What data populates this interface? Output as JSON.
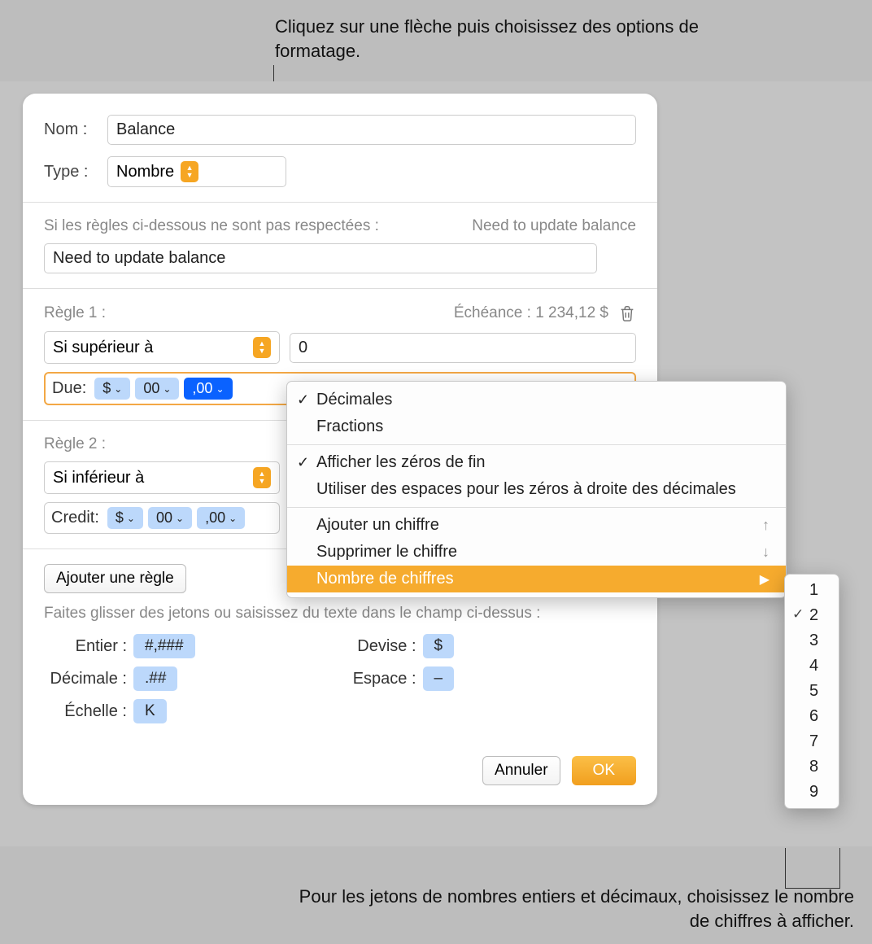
{
  "callouts": {
    "top": "Cliquez sur une flèche puis choisissez des options de formatage.",
    "bottom": "Pour les jetons de nombres entiers et décimaux, choisissez le nombre de chiffres à afficher."
  },
  "form": {
    "name_label": "Nom :",
    "name_value": "Balance",
    "type_label": "Type :",
    "type_value": "Nombre",
    "fallback_label": "Si les règles ci-dessous ne sont pas respectées :",
    "fallback_preview": "Need to update balance",
    "fallback_value": "Need to update balance"
  },
  "rule1": {
    "title": "Règle 1 :",
    "preview": "Échéance : 1 234,12 $",
    "condition": "Si supérieur à",
    "value": "0",
    "prefix": "Due:",
    "t1": "$",
    "t2": "00",
    "t3": ",00"
  },
  "rule2": {
    "title": "Règle 2 :",
    "condition": "Si inférieur à",
    "prefix": "Credit:",
    "t1": "$",
    "t2": "00",
    "t3": ",00"
  },
  "add_rule": "Ajouter une règle",
  "tokens_hint": "Faites glisser des jetons ou saisissez du texte dans le champ ci-dessus :",
  "tg": {
    "entier_l": "Entier :",
    "entier_v": "#,###",
    "decimale_l": "Décimale :",
    "decimale_v": ".##",
    "echelle_l": "Échelle :",
    "echelle_v": "K",
    "devise_l": "Devise :",
    "devise_v": "$",
    "espace_l": "Espace :",
    "espace_v": "–"
  },
  "buttons": {
    "cancel": "Annuler",
    "ok": "OK"
  },
  "popup": {
    "decimales": "Décimales",
    "fractions": "Fractions",
    "zeros_fin": "Afficher les zéros de fin",
    "espaces_zeros": "Utiliser des espaces pour les zéros à droite des décimales",
    "ajouter": "Ajouter un chiffre",
    "supprimer": "Supprimer le chiffre",
    "nombre": "Nombre de chiffres"
  },
  "submenu": [
    "1",
    "2",
    "3",
    "4",
    "5",
    "6",
    "7",
    "8",
    "9"
  ]
}
